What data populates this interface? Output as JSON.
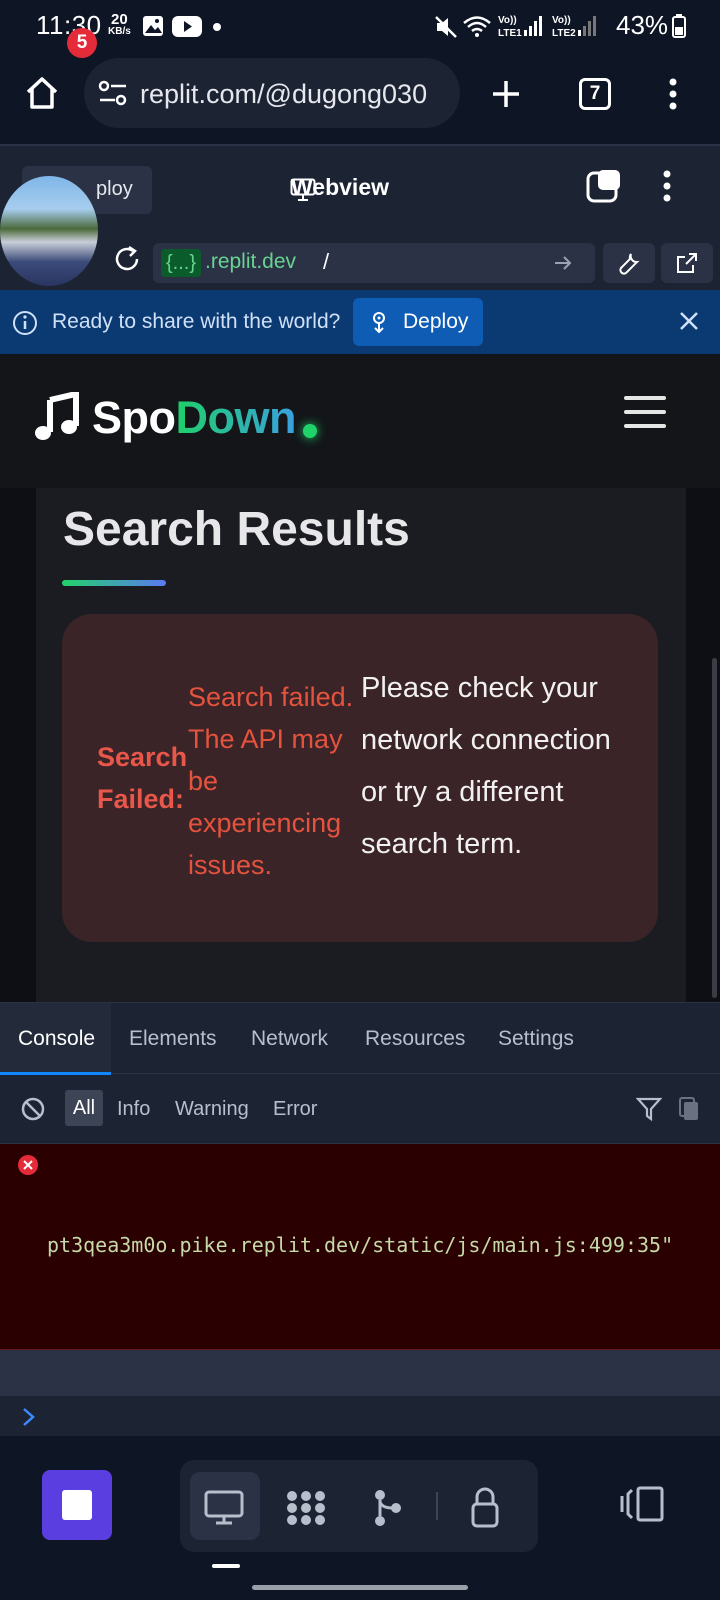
{
  "status_bar": {
    "time": "11:30",
    "net_speed_value": "20",
    "net_speed_unit": "KB/s",
    "battery": "43%"
  },
  "browser": {
    "url": "replit.com/@dugong030",
    "tab_count": "7"
  },
  "replit_header": {
    "deploy_tab_label": "ploy",
    "notification_count": "5",
    "webview_title": "Webview",
    "url_chip": "{...}",
    "url_host": ".replit.dev",
    "url_path": "/"
  },
  "banner": {
    "message": "Ready to share with the world?",
    "deploy_label": "Deploy"
  },
  "site": {
    "logo_part1": "Spo",
    "logo_part2": "Down",
    "page_title": "Search Results",
    "error_heading": "Search Failed:",
    "error_api": "Search failed. The API may be experiencing issues.",
    "error_hint": "Please check your network connection or try a different search term."
  },
  "devtools": {
    "tabs": [
      "Console",
      "Elements",
      "Network",
      "Resources",
      "Settings"
    ],
    "filters": [
      "All",
      "Info",
      "Warning",
      "Error"
    ],
    "error_source": "pt3qea3m0o.pike.replit.dev/static/js/main.js:499:35\""
  },
  "colors": {
    "accent_blue": "#0f87ff",
    "error_red": "#e5533f",
    "brand_green": "#1fcf6a",
    "stop_purple": "#5b3ee0"
  }
}
